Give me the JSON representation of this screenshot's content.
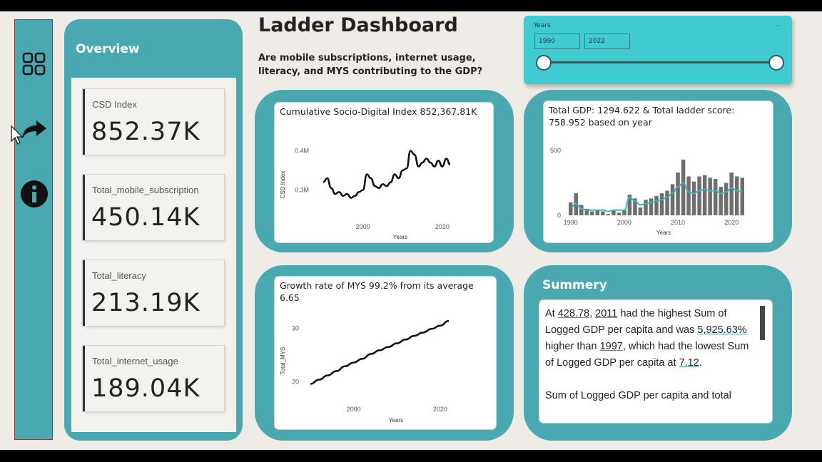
{
  "nav": {
    "items": [
      {
        "name": "grid-icon"
      },
      {
        "name": "forward-arrow-icon"
      },
      {
        "name": "info-icon"
      }
    ]
  },
  "overview": {
    "title": "Overview",
    "kpis": [
      {
        "label": "CSD Index",
        "value": "852.37K"
      },
      {
        "label": "Total_mobile_subscription",
        "value": "450.14K"
      },
      {
        "label": "Total_literacy",
        "value": "213.19K"
      },
      {
        "label": "Total_internet_usage",
        "value": "189.04K"
      }
    ]
  },
  "header": {
    "title": "Ladder Dashboard",
    "question": "Are mobile subscriptions, internet usage, literacy, and MYS contributing to the GDP?"
  },
  "slicer": {
    "title": "Years",
    "from": "1990",
    "to": "2022",
    "range_fraction": [
      0,
      1
    ]
  },
  "chart_data": [
    {
      "type": "line",
      "title": "Cumulative Socio-Digital Index 852,367.81K",
      "xlabel": "Years",
      "ylabel": "CSD Index",
      "yticks": [
        "0.4M",
        "0.3M"
      ],
      "xticks": [
        "2000",
        "2020"
      ],
      "x": [
        1990,
        1991,
        1992,
        1993,
        1994,
        1995,
        1996,
        1997,
        1998,
        1999,
        2000,
        2001,
        2002,
        2003,
        2004,
        2005,
        2006,
        2007,
        2008,
        2009,
        2010,
        2011,
        2012,
        2013,
        2014,
        2015,
        2016,
        2017,
        2018,
        2019,
        2020,
        2021,
        2022
      ],
      "y": [
        0.32,
        0.33,
        0.305,
        0.29,
        0.295,
        0.285,
        0.29,
        0.28,
        0.285,
        0.295,
        0.3,
        0.34,
        0.33,
        0.31,
        0.305,
        0.315,
        0.31,
        0.32,
        0.34,
        0.33,
        0.35,
        0.355,
        0.4,
        0.39,
        0.36,
        0.37,
        0.38,
        0.37,
        0.36,
        0.375,
        0.36,
        0.38,
        0.365
      ],
      "ylim": [
        0.25,
        0.45
      ],
      "color": "#111111"
    },
    {
      "type": "bar",
      "title": "Total GDP: 1294.622 & Total ladder score: 758.952 based on year",
      "xlabel": "Years",
      "yticks": [
        "500",
        "0"
      ],
      "xticks": [
        "1990",
        "2000",
        "2010",
        "2020"
      ],
      "x": [
        1990,
        1991,
        1992,
        1993,
        1994,
        1995,
        1996,
        1997,
        1998,
        1999,
        2000,
        2001,
        2002,
        2003,
        2004,
        2005,
        2006,
        2007,
        2008,
        2009,
        2010,
        2011,
        2012,
        2013,
        2014,
        2015,
        2016,
        2017,
        2018,
        2019,
        2020,
        2021,
        2022
      ],
      "series": [
        {
          "values": [
            100,
            170,
            80,
            50,
            30,
            40,
            30,
            10,
            40,
            20,
            40,
            160,
            130,
            60,
            120,
            130,
            150,
            170,
            190,
            240,
            330,
            430,
            300,
            260,
            300,
            310,
            290,
            280,
            220,
            250,
            330,
            300,
            290
          ],
          "color": "#6e6e6e"
        },
        {
          "values": [
            60,
            90,
            50,
            40,
            40,
            40,
            40,
            30,
            40,
            40,
            40,
            140,
            110,
            80,
            90,
            100,
            110,
            120,
            140,
            170,
            220,
            250,
            180,
            170,
            190,
            200,
            190,
            190,
            170,
            180,
            210,
            190,
            180
          ],
          "color": "#3fb4c0"
        }
      ],
      "ylim": [
        0,
        550
      ]
    },
    {
      "type": "line",
      "title": "Growth rate of MYS 99.2% from its average 6.65",
      "xlabel": "Years",
      "ylabel": "Total_MYS",
      "yticks": [
        "30",
        "20"
      ],
      "xticks": [
        "2000",
        "2020"
      ],
      "x": [
        1990,
        1992,
        1994,
        1996,
        1998,
        2000,
        2002,
        2004,
        2006,
        2008,
        2010,
        2012,
        2014,
        2016,
        2018,
        2020,
        2022
      ],
      "y": [
        19.6,
        20.4,
        21.2,
        22,
        22.9,
        23.6,
        24.3,
        25.2,
        25.9,
        26.5,
        27.2,
        27.9,
        28.6,
        29.2,
        29.9,
        30.5,
        31.4
      ],
      "ylim": [
        17,
        33
      ],
      "color": "#111111"
    }
  ],
  "summary": {
    "title": "Summery",
    "p1_a": "At ",
    "p1_b": "428.78",
    "p1_c": ", ",
    "p1_d": "2011",
    "p1_e": " had the highest Sum of Logged GDP per capita and was ",
    "p1_f": "5,925.63%",
    "p1_g": " higher than ",
    "p1_h": "1997",
    "p1_i": ", which had the lowest Sum of Logged GDP per capita at ",
    "p1_j": "7.12",
    "p1_k": ".",
    "p2": "Sum of Logged GDP per capita and total"
  }
}
